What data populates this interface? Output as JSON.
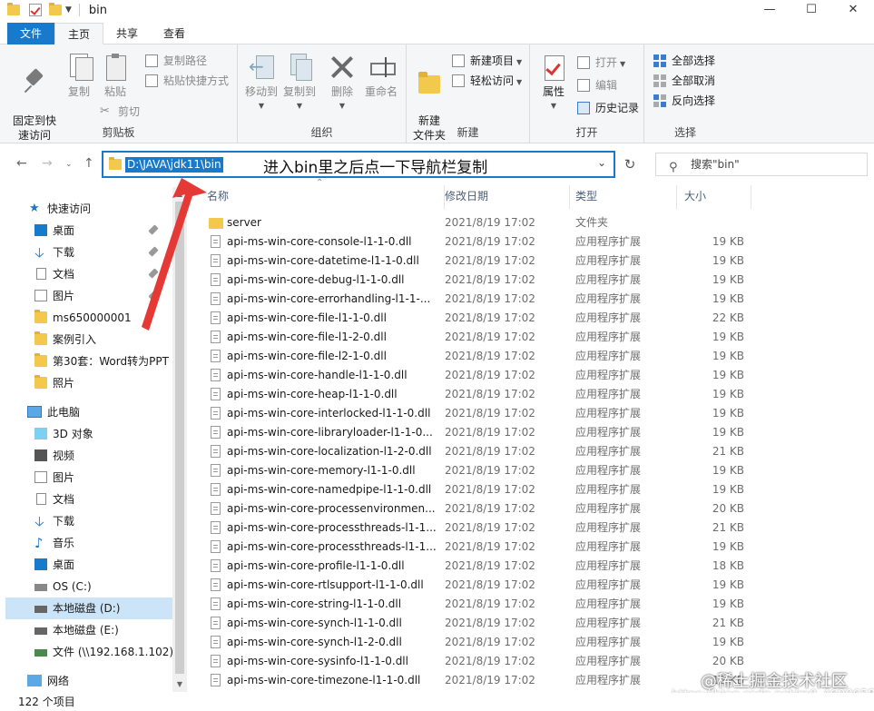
{
  "window": {
    "title": "bin",
    "controls": [
      "—",
      "☐",
      "✕"
    ]
  },
  "tabs": [
    "文件",
    "主页",
    "共享",
    "查看"
  ],
  "ribbon": {
    "clipboard": {
      "label": "剪贴板",
      "pin": "固定到快\n速访问",
      "copy": "复制",
      "paste": "粘贴",
      "copy_path": "复制路径",
      "paste_shortcut": "粘贴快捷方式",
      "cut": "剪切"
    },
    "organize": {
      "label": "组织",
      "move_to": "移动到",
      "copy_to": "复制到",
      "delete": "删除",
      "rename": "重命名"
    },
    "new": {
      "label": "新建",
      "new_folder": "新建\n文件夹",
      "new_item": "新建项目",
      "easy_access": "轻松访问"
    },
    "open": {
      "label": "打开",
      "properties": "属性",
      "open": "打开",
      "edit": "编辑",
      "history": "历史记录"
    },
    "select": {
      "label": "选择",
      "select_all": "全部选择",
      "select_none": "全部取消",
      "invert": "反向选择"
    }
  },
  "address": {
    "path": "D:\\JAVA\\jdk11\\bin",
    "annotation": "进入bin里之后点一下导航栏复制",
    "search_placeholder": "搜索\"bin\""
  },
  "nav": {
    "quick_access": "快速访问",
    "quick_items": [
      "桌面",
      "下载",
      "文档",
      "图片",
      "ms650000001",
      "案例引入",
      "第30套：Word转为PPT",
      "照片"
    ],
    "this_pc": "此电脑",
    "pc_items": [
      "3D 对象",
      "视频",
      "图片",
      "文档",
      "下载",
      "音乐",
      "桌面",
      "OS (C:)",
      "本地磁盘 (D:)",
      "本地磁盘 (E:)",
      "文件 (\\\\192.168.1.102) ("
    ],
    "network": "网络"
  },
  "columns": {
    "name": "名称",
    "date": "修改日期",
    "type": "类型",
    "size": "大小"
  },
  "files": [
    {
      "name": "server",
      "date": "2021/8/19 17:02",
      "type": "文件夹",
      "size": "",
      "folder": true
    },
    {
      "name": "api-ms-win-core-console-l1-1-0.dll",
      "date": "2021/8/19 17:02",
      "type": "应用程序扩展",
      "size": "19 KB"
    },
    {
      "name": "api-ms-win-core-datetime-l1-1-0.dll",
      "date": "2021/8/19 17:02",
      "type": "应用程序扩展",
      "size": "19 KB"
    },
    {
      "name": "api-ms-win-core-debug-l1-1-0.dll",
      "date": "2021/8/19 17:02",
      "type": "应用程序扩展",
      "size": "19 KB"
    },
    {
      "name": "api-ms-win-core-errorhandling-l1-1-...",
      "date": "2021/8/19 17:02",
      "type": "应用程序扩展",
      "size": "19 KB"
    },
    {
      "name": "api-ms-win-core-file-l1-1-0.dll",
      "date": "2021/8/19 17:02",
      "type": "应用程序扩展",
      "size": "22 KB"
    },
    {
      "name": "api-ms-win-core-file-l1-2-0.dll",
      "date": "2021/8/19 17:02",
      "type": "应用程序扩展",
      "size": "19 KB"
    },
    {
      "name": "api-ms-win-core-file-l2-1-0.dll",
      "date": "2021/8/19 17:02",
      "type": "应用程序扩展",
      "size": "19 KB"
    },
    {
      "name": "api-ms-win-core-handle-l1-1-0.dll",
      "date": "2021/8/19 17:02",
      "type": "应用程序扩展",
      "size": "19 KB"
    },
    {
      "name": "api-ms-win-core-heap-l1-1-0.dll",
      "date": "2021/8/19 17:02",
      "type": "应用程序扩展",
      "size": "19 KB"
    },
    {
      "name": "api-ms-win-core-interlocked-l1-1-0.dll",
      "date": "2021/8/19 17:02",
      "type": "应用程序扩展",
      "size": "19 KB"
    },
    {
      "name": "api-ms-win-core-libraryloader-l1-1-0...",
      "date": "2021/8/19 17:02",
      "type": "应用程序扩展",
      "size": "19 KB"
    },
    {
      "name": "api-ms-win-core-localization-l1-2-0.dll",
      "date": "2021/8/19 17:02",
      "type": "应用程序扩展",
      "size": "21 KB"
    },
    {
      "name": "api-ms-win-core-memory-l1-1-0.dll",
      "date": "2021/8/19 17:02",
      "type": "应用程序扩展",
      "size": "19 KB"
    },
    {
      "name": "api-ms-win-core-namedpipe-l1-1-0.dll",
      "date": "2021/8/19 17:02",
      "type": "应用程序扩展",
      "size": "19 KB"
    },
    {
      "name": "api-ms-win-core-processenvironmen...",
      "date": "2021/8/19 17:02",
      "type": "应用程序扩展",
      "size": "20 KB"
    },
    {
      "name": "api-ms-win-core-processthreads-l1-1...",
      "date": "2021/8/19 17:02",
      "type": "应用程序扩展",
      "size": "21 KB"
    },
    {
      "name": "api-ms-win-core-processthreads-l1-1...",
      "date": "2021/8/19 17:02",
      "type": "应用程序扩展",
      "size": "19 KB"
    },
    {
      "name": "api-ms-win-core-profile-l1-1-0.dll",
      "date": "2021/8/19 17:02",
      "type": "应用程序扩展",
      "size": "18 KB"
    },
    {
      "name": "api-ms-win-core-rtlsupport-l1-1-0.dll",
      "date": "2021/8/19 17:02",
      "type": "应用程序扩展",
      "size": "19 KB"
    },
    {
      "name": "api-ms-win-core-string-l1-1-0.dll",
      "date": "2021/8/19 17:02",
      "type": "应用程序扩展",
      "size": "19 KB"
    },
    {
      "name": "api-ms-win-core-synch-l1-1-0.dll",
      "date": "2021/8/19 17:02",
      "type": "应用程序扩展",
      "size": "21 KB"
    },
    {
      "name": "api-ms-win-core-synch-l1-2-0.dll",
      "date": "2021/8/19 17:02",
      "type": "应用程序扩展",
      "size": "19 KB"
    },
    {
      "name": "api-ms-win-core-sysinfo-l1-1-0.dll",
      "date": "2021/8/19 17:02",
      "type": "应用程序扩展",
      "size": "20 KB"
    },
    {
      "name": "api-ms-win-core-timezone-l1-1-0.dll",
      "date": "2021/8/19 17:02",
      "type": "应用程序扩展",
      "size": "19 KB"
    }
  ],
  "status": {
    "count": "122 个项目"
  },
  "watermark": {
    "main": "@稀土掘金技术社区",
    "sub": "https://blog.csdn.net/m0_46006580"
  },
  "colors": {
    "accent": "#1979ca",
    "annotation_arrow": "#e53935"
  }
}
